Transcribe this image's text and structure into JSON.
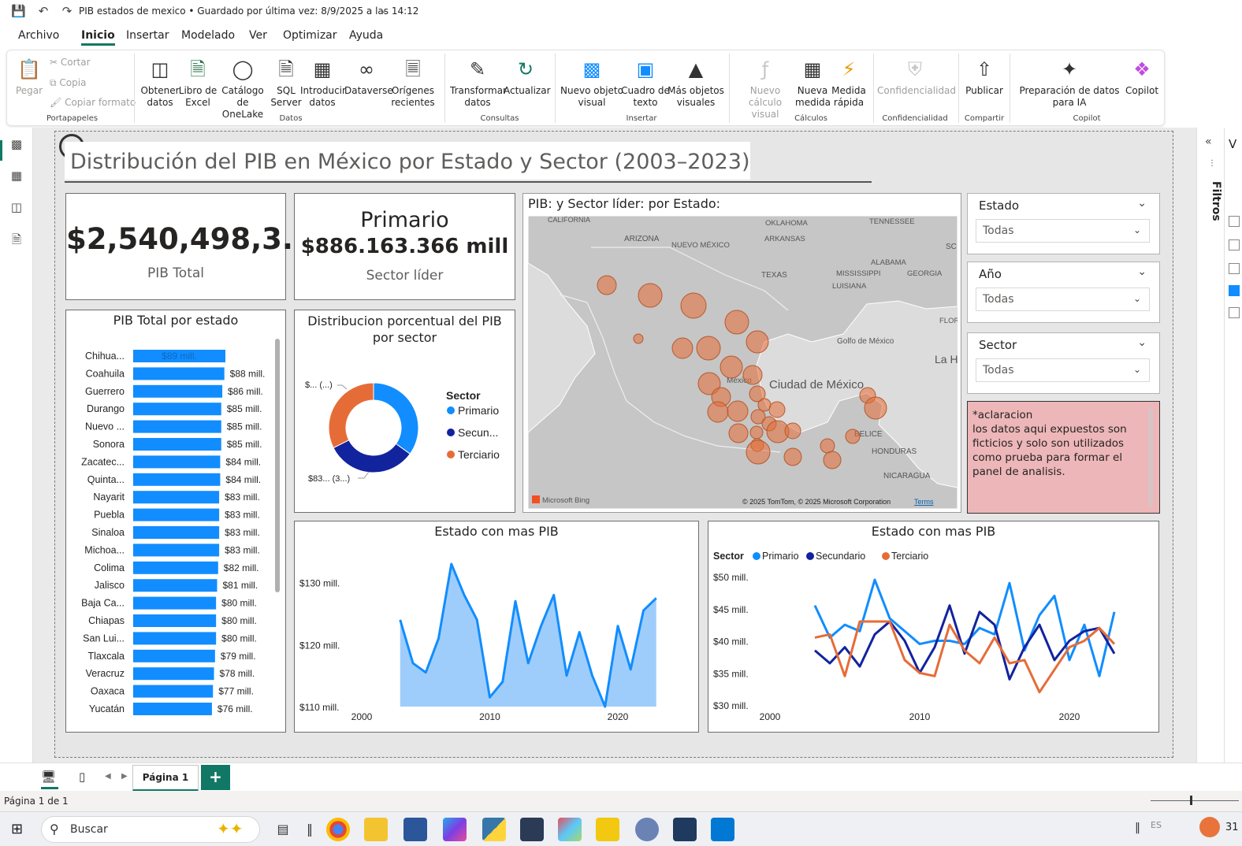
{
  "titlebar": {
    "title": "PIB estados de mexico • Guardado por última vez: 8/9/2025 a las 14:12"
  },
  "menu": {
    "items": [
      "Archivo",
      "Inicio",
      "Insertar",
      "Modelado",
      "Ver",
      "Optimizar",
      "Ayuda"
    ],
    "active": "Inicio"
  },
  "ribbon": {
    "paste": "Pegar",
    "cut": "Cortar",
    "copy": "Copia",
    "format": "Copiar formato",
    "get_data": "Obtener datos",
    "excel": "Libro de Excel",
    "onelake": "Catálogo de OneLake",
    "sql": "SQL Server",
    "enter_data": "Introducir datos",
    "dataverse": "Dataverse",
    "recent": "Orígenes recientes",
    "transform": "Transformar datos",
    "refresh": "Actualizar",
    "new_visual": "Nuevo objeto visual",
    "textbox": "Cuadro de texto",
    "more_visuals": "Más objetos visuales",
    "new_calc": "Nuevo cálculo visual",
    "new_measure": "Nueva medida",
    "quick_measure": "Medida rápida",
    "sensitivity": "Confidencialidad",
    "publish": "Publicar",
    "copilot_prep": "Preparación de datos para IA",
    "copilot": "Copilot",
    "groups": {
      "clipboard": "Portapapeles",
      "data": "Datos",
      "queries": "Consultas",
      "insert": "Insertar",
      "calc": "Cálculos",
      "sens": "Confidencialidad",
      "share": "Compartir",
      "copilot": "Copilot"
    }
  },
  "report": {
    "title": "Distribución del PIB en México por Estado y Sector (2003–2023)",
    "kpi_total": {
      "value": "$2,540,498,3...",
      "label": "PIB Total"
    },
    "kpi_sector": {
      "name": "Primario",
      "value": "$886.163.366 mill",
      "label": "Sector líder"
    },
    "map": {
      "title": "PIB: y Sector líder: por Estado:",
      "labels": [
        "CALIFORNIA",
        "ARIZONA",
        "NUEVO MÉXICO",
        "OKLAHOMA",
        "ARKANSAS",
        "TENNESSEE",
        "TEXAS",
        "MISSISSIPPI",
        "ALABAMA",
        "GEORGIA",
        "LUISIANA",
        "FLORIDA",
        "Golfo de México",
        "La H",
        "Ciudad de México",
        "México",
        "BELICE",
        "HONDURAS",
        "NICARAGUA",
        "SC"
      ],
      "bing": "Microsoft Bing",
      "copyright": "© 2025 TomTom, © 2025 Microsoft Corporation",
      "terms": "Terms"
    },
    "slicers": [
      {
        "label": "Estado",
        "value": "Todas"
      },
      {
        "label": "Año",
        "value": "Todas"
      },
      {
        "label": "Sector",
        "value": "Todas"
      }
    ],
    "note": "*aclaracion\nlos datos aqui expuestos son ficticios y solo son utilizados como prueba para formar el panel de analisis."
  },
  "rightpane": {
    "filters": "Filtros"
  },
  "pages": {
    "tab": "Página 1",
    "add": "+"
  },
  "status": {
    "page_count": "Página 1 de 1"
  },
  "taskbar": {
    "search": "Buscar",
    "lang": "ES",
    "time": "31"
  },
  "colors": {
    "primary": "#118DFF",
    "secondary": "#12239E",
    "tertiary": "#E66C37",
    "bar": "#118DFF",
    "accent": "#117865",
    "note_bg": "#EDB6B8"
  },
  "chart_data": [
    {
      "type": "bar",
      "title": "PIB Total por estado",
      "orientation": "horizontal",
      "categories": [
        "Chihua...",
        "Coahuila",
        "Guerrero",
        "Durango",
        "Nuevo ...",
        "Sonora",
        "Zacatec...",
        "Quinta...",
        "Nayarit",
        "Puebla",
        "Sinaloa",
        "Michoa...",
        "Colima",
        "Jalisco",
        "Baja Ca...",
        "Chiapas",
        "San Lui...",
        "Tlaxcala",
        "Veracruz",
        "Oaxaca",
        "Yucatán"
      ],
      "values": [
        89,
        88,
        86,
        85,
        85,
        85,
        84,
        84,
        83,
        83,
        83,
        83,
        82,
        81,
        80,
        80,
        80,
        79,
        78,
        77,
        76
      ],
      "data_labels": [
        "$89 mill.",
        "$88 mill.",
        "$86 mill.",
        "$85 mill.",
        "$85 mill.",
        "$85 mill.",
        "$84 mill.",
        "$84 mill.",
        "$83 mill.",
        "$83 mill.",
        "$83 mill.",
        "$83 mill.",
        "$82 mill.",
        "$81 mill.",
        "$80 mill.",
        "$80 mill.",
        "$80 mill.",
        "$79 mill.",
        "$78 mill.",
        "$77 mill.",
        "$76 mill."
      ]
    },
    {
      "type": "pie",
      "title": "Distribucion porcentual del PIB por sector",
      "legend_title": "Sector",
      "categories": [
        "Primario",
        "Secun...",
        "Terciario"
      ],
      "values": [
        34.9,
        32.7,
        32.4
      ],
      "data_labels": [
        "$... (...)",
        "$83... (3...)"
      ]
    },
    {
      "type": "area",
      "title": "Estado con mas PIB",
      "x": [
        2003,
        2004,
        2005,
        2006,
        2007,
        2008,
        2009,
        2010,
        2011,
        2012,
        2013,
        2014,
        2015,
        2016,
        2017,
        2018,
        2019,
        2020,
        2021,
        2022,
        2023
      ],
      "values": [
        124,
        117,
        115.5,
        121,
        133,
        128,
        124,
        111.5,
        114,
        127,
        117,
        123,
        128,
        115,
        122,
        115,
        110,
        123,
        116,
        125.5,
        127.5
      ],
      "xticks": [
        "2000",
        "2010",
        "2020"
      ],
      "yticks": [
        "$110 mill.",
        "$120 mill.",
        "$130 mill."
      ],
      "xlim": [
        2000,
        2024
      ],
      "ylim": [
        110,
        133
      ]
    },
    {
      "type": "line",
      "title": "Estado con mas PIB",
      "legend_title": "Sector",
      "x": [
        2003,
        2004,
        2005,
        2006,
        2007,
        2008,
        2009,
        2010,
        2011,
        2012,
        2013,
        2014,
        2015,
        2016,
        2017,
        2018,
        2019,
        2020,
        2021,
        2022,
        2023
      ],
      "series": [
        {
          "name": "Primario",
          "values": [
            45.5,
            40.5,
            42.5,
            41.5,
            49.5,
            43.5,
            41.5,
            39.5,
            40,
            40,
            39.5,
            42,
            41,
            49,
            38.5,
            44,
            47,
            37,
            42.5,
            34.5,
            44.5
          ]
        },
        {
          "name": "Secundario",
          "values": [
            38.5,
            36.5,
            39,
            36,
            41,
            43,
            40,
            35,
            39,
            45.5,
            38,
            44.5,
            42.5,
            34,
            39,
            42.5,
            37,
            40,
            41.5,
            42,
            38
          ]
        },
        {
          "name": "Terciario",
          "values": [
            40.5,
            41,
            34.5,
            43,
            43,
            43,
            37,
            35,
            34.5,
            42.5,
            38.5,
            36.5,
            40.5,
            36.5,
            37,
            32,
            35.5,
            39,
            40,
            42,
            39.5
          ]
        }
      ],
      "xticks": [
        "2000",
        "2010",
        "2020"
      ],
      "yticks": [
        "$30 mill.",
        "$35 mill.",
        "$40 mill.",
        "$45 mill.",
        "$50 mill."
      ],
      "xlim": [
        2000,
        2024
      ],
      "ylim": [
        30,
        50
      ]
    }
  ]
}
